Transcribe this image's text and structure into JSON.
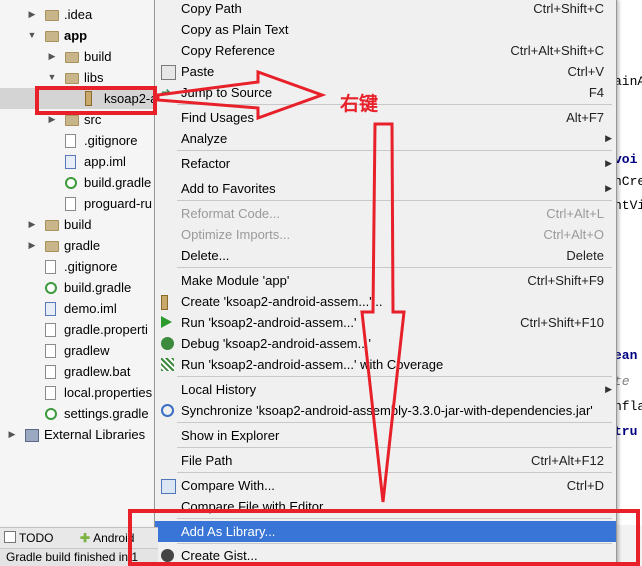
{
  "tree": {
    "items": [
      {
        "label": ".idea",
        "kind": "folder",
        "arrow": "▶",
        "indent": 1
      },
      {
        "label": "app",
        "kind": "folder",
        "arrow": "▼",
        "indent": 1,
        "bold": true
      },
      {
        "label": "build",
        "kind": "folder",
        "arrow": "▶",
        "indent": 2
      },
      {
        "label": "libs",
        "kind": "folder",
        "arrow": "▼",
        "indent": 2
      },
      {
        "label": "ksoap2-a",
        "kind": "jar",
        "arrow": "",
        "indent": 3,
        "selected": true
      },
      {
        "label": "src",
        "kind": "folder",
        "arrow": "▶",
        "indent": 2
      },
      {
        "label": ".gitignore",
        "kind": "file",
        "arrow": "",
        "indent": 2
      },
      {
        "label": "app.iml",
        "kind": "iml",
        "arrow": "",
        "indent": 2
      },
      {
        "label": "build.gradle",
        "kind": "gradle",
        "arrow": "",
        "indent": 2
      },
      {
        "label": "proguard-ru",
        "kind": "file",
        "arrow": "",
        "indent": 2
      },
      {
        "label": "build",
        "kind": "folder",
        "arrow": "▶",
        "indent": 1
      },
      {
        "label": "gradle",
        "kind": "folder",
        "arrow": "▶",
        "indent": 1
      },
      {
        "label": ".gitignore",
        "kind": "file",
        "arrow": "",
        "indent": 1
      },
      {
        "label": "build.gradle",
        "kind": "gradle",
        "arrow": "",
        "indent": 1
      },
      {
        "label": "demo.iml",
        "kind": "iml",
        "arrow": "",
        "indent": 1
      },
      {
        "label": "gradle.properti",
        "kind": "file",
        "arrow": "",
        "indent": 1
      },
      {
        "label": "gradlew",
        "kind": "file",
        "arrow": "",
        "indent": 1
      },
      {
        "label": "gradlew.bat",
        "kind": "file",
        "arrow": "",
        "indent": 1
      },
      {
        "label": "local.properties",
        "kind": "file",
        "arrow": "",
        "indent": 1
      },
      {
        "label": "settings.gradle",
        "kind": "gradle",
        "arrow": "",
        "indent": 1
      },
      {
        "label": "External Libraries",
        "kind": "extlib",
        "arrow": "▶",
        "indent": 0
      }
    ]
  },
  "editor": {
    "lines": [
      {
        "text": "ainA",
        "style": ""
      },
      {
        "text": "voi",
        "style": "kw"
      },
      {
        "text": "nCre",
        "style": ""
      },
      {
        "text": "ntVi",
        "style": ""
      },
      {
        "text": "ean",
        "style": "kw"
      },
      {
        "text": "te",
        "style": "it"
      },
      {
        "text": "nfla",
        "style": ""
      },
      {
        "text": "tru",
        "style": "kw"
      }
    ]
  },
  "menu": {
    "items": [
      {
        "label": "Copy Path",
        "shortcut": "Ctrl+Shift+C"
      },
      {
        "label": "Copy as Plain Text",
        "shortcut": ""
      },
      {
        "label": "Copy Reference",
        "shortcut": "Ctrl+Alt+Shift+C"
      },
      {
        "label": "Paste",
        "shortcut": "Ctrl+V",
        "icon": "paste-icon"
      },
      {
        "label": "Jump to Source",
        "shortcut": "F4",
        "icon": "jump-to-source-icon"
      },
      {
        "label": "Find Usages",
        "shortcut": "Alt+F7"
      },
      {
        "label": "Analyze",
        "shortcut": "",
        "submenu": true
      },
      {
        "label": "Refactor",
        "shortcut": "",
        "submenu": true
      },
      {
        "label": "Add to Favorites",
        "shortcut": "",
        "submenu": true
      },
      {
        "label": "Reformat Code...",
        "shortcut": "Ctrl+Alt+L",
        "disabled": true
      },
      {
        "label": "Optimize Imports...",
        "shortcut": "Ctrl+Alt+O",
        "disabled": true
      },
      {
        "label": "Delete...",
        "shortcut": "Delete"
      },
      {
        "label": "Make Module 'app'",
        "shortcut": "Ctrl+Shift+F9"
      },
      {
        "label": "Create 'ksoap2-android-assem...'...",
        "shortcut": "",
        "icon": "create-config-icon"
      },
      {
        "label": "Run 'ksoap2-android-assem...'",
        "shortcut": "Ctrl+Shift+F10",
        "icon": "run-icon"
      },
      {
        "label": "Debug 'ksoap2-android-assem...'",
        "shortcut": "",
        "icon": "debug-icon"
      },
      {
        "label": "Run 'ksoap2-android-assem...' with Coverage",
        "shortcut": "",
        "icon": "coverage-icon"
      },
      {
        "label": "Local History",
        "shortcut": "",
        "submenu": true
      },
      {
        "label": "Synchronize 'ksoap2-android-assembly-3.3.0-jar-with-dependencies.jar'",
        "shortcut": "",
        "icon": "sync-icon"
      },
      {
        "label": "Show in Explorer",
        "shortcut": ""
      },
      {
        "label": "File Path",
        "shortcut": "Ctrl+Alt+F12"
      },
      {
        "label": "Compare With...",
        "shortcut": "Ctrl+D",
        "icon": "compare-icon"
      },
      {
        "label": "Compare File with Editor",
        "shortcut": ""
      },
      {
        "label": "Add As Library...",
        "shortcut": "",
        "highlight": true
      },
      {
        "label": "Create Gist...",
        "shortcut": "",
        "icon": "gist-icon"
      }
    ]
  },
  "toolbar": {
    "todo_label": "TODO",
    "android_label": "Android"
  },
  "status": {
    "text": "Gradle build finished in 1"
  },
  "annotation": {
    "right_click_text": "右键"
  },
  "colors": {
    "annotation_red": "#e8202a",
    "menu_highlight": "#3875d7",
    "selection": "#d4d4d4"
  }
}
